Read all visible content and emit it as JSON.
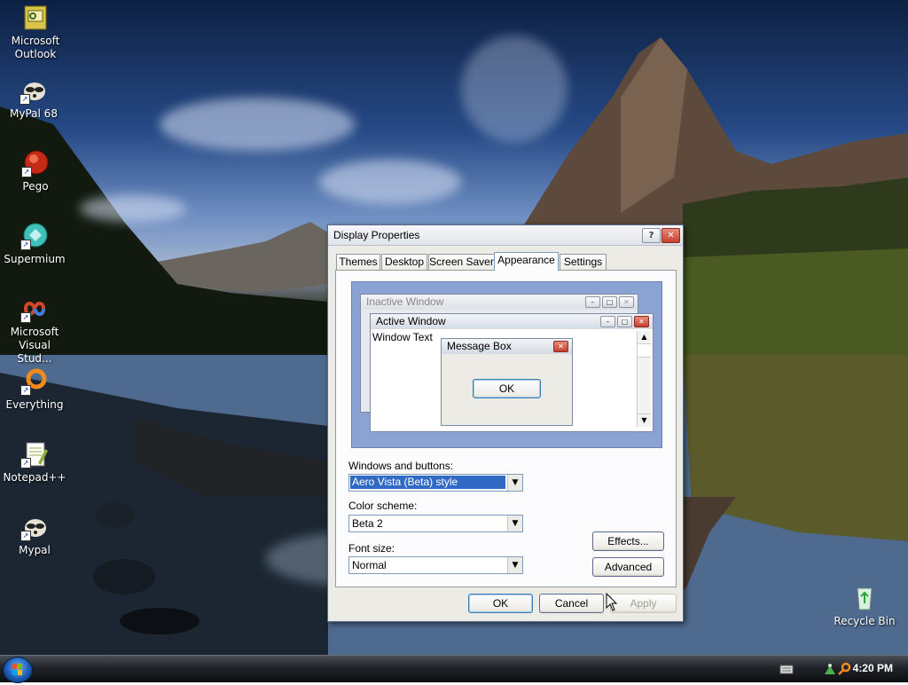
{
  "desktop": {
    "icons": [
      {
        "label": "Microsoft\nOutlook"
      },
      {
        "label": "MyPal 68"
      },
      {
        "label": "Pego"
      },
      {
        "label": "Supermium"
      },
      {
        "label": "Microsoft\nVisual Stud..."
      },
      {
        "label": "Everything"
      },
      {
        "label": "Notepad++"
      },
      {
        "label": "Mypal"
      },
      {
        "label": "Recycle Bin"
      }
    ]
  },
  "dialog": {
    "title": "Display Properties",
    "tabs": [
      {
        "label": "Themes"
      },
      {
        "label": "Desktop"
      },
      {
        "label": "Screen Saver"
      },
      {
        "label": "Appearance",
        "active": true
      },
      {
        "label": "Settings"
      }
    ],
    "preview": {
      "inactive_title": "Inactive Window",
      "active_title": "Active Window",
      "window_text": "Window Text",
      "message_title": "Message Box",
      "message_ok": "OK"
    },
    "windows_buttons": {
      "label": "Windows and buttons:",
      "value": "Aero Vista (Beta) style"
    },
    "color_scheme": {
      "label": "Color scheme:",
      "value": "Beta 2"
    },
    "font_size": {
      "label": "Font size:",
      "value": "Normal"
    },
    "effects_button": "Effects...",
    "advanced_button": "Advanced",
    "ok_button": "OK",
    "cancel_button": "Cancel",
    "apply_button": "Apply"
  },
  "taskbar": {
    "clock": "4:20 PM"
  },
  "colors": {
    "selection": "#316ac5",
    "preview_bg": "#8ba3d2",
    "dialog_bg": "#ecebe6"
  }
}
